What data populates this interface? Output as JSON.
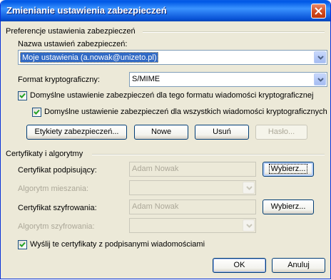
{
  "window": {
    "title": "Zmienianie ustawienia zabezpieczeń"
  },
  "preferences": {
    "group_title": "Preferencje ustawienia zabezpieczeń",
    "name_label": "Nazwa ustawień zabezpieczeń:",
    "name_value": "Moje ustawienia (a.nowak@unizeto.pl)",
    "format_label": "Format kryptograficzny:",
    "format_value": "S/MIME",
    "default_format_checkbox": "Domyślne ustawienie zabezpieczeń dla tego formatu wiadomości kryptograficznej",
    "default_all_checkbox": "Domyślne ustawienie zabezpieczeń dla wszystkich wiadomości kryptograficznych",
    "default_format_checked": true,
    "default_all_checked": true,
    "labels_button": "Etykiety zabezpieczeń...",
    "new_button": "Nowe",
    "delete_button": "Usuń",
    "password_button": "Hasło..."
  },
  "certificates": {
    "group_title": "Certyfikaty i algorytmy",
    "signing_cert_label": "Certyfikat podpisujący:",
    "signing_cert_value": "Adam Nowak",
    "hash_alg_label": "Algorytm mieszania:",
    "hash_alg_value": "",
    "encryption_cert_label": "Certyfikat szyfrowania:",
    "encryption_cert_value": "Adam Nowak",
    "encryption_alg_label": "Algorytm szyfrowania:",
    "encryption_alg_value": "",
    "choose_button": "Wybierz...",
    "send_certs_checkbox": "Wyślij te certyfikaty z podpisanymi wiadomościami",
    "send_certs_checked": true
  },
  "footer": {
    "ok_button": "OK",
    "cancel_button": "Anuluj"
  },
  "colors": {
    "titlebar": "#0058e6",
    "dialog_bg": "#ece9d8",
    "selection": "#316ac5",
    "disabled_text": "#aca899"
  }
}
